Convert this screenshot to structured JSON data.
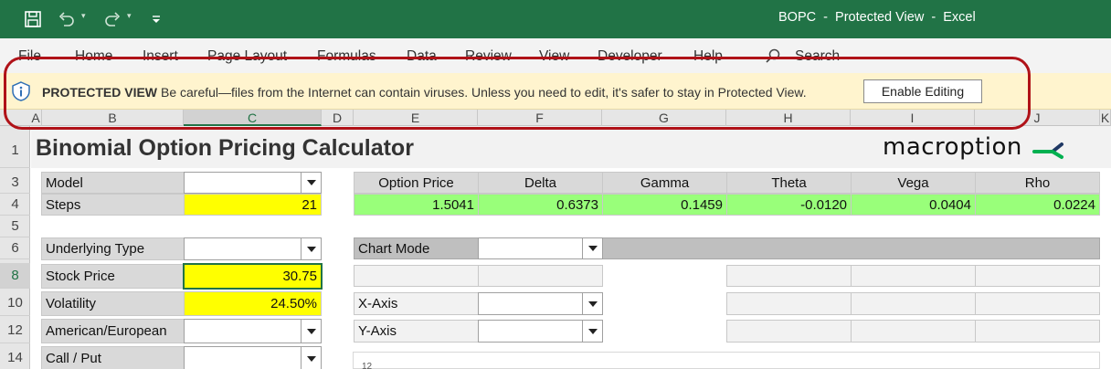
{
  "window": {
    "title": "BOPC  -  Protected View  -  Excel"
  },
  "ribbon": {
    "tabs": [
      "File",
      "Home",
      "Insert",
      "Page Layout",
      "Formulas",
      "Data",
      "Review",
      "View",
      "Developer",
      "Help"
    ],
    "search_label": "Search"
  },
  "protected_view": {
    "title": "PROTECTED VIEW",
    "message": "Be careful—files from the Internet can contain viruses. Unless you need to edit, it's safer to stay in Protected View.",
    "button": "Enable Editing"
  },
  "columns": [
    "A",
    "B",
    "C",
    "D",
    "E",
    "F",
    "G",
    "H",
    "I",
    "J",
    "K"
  ],
  "rows": [
    "1",
    "3",
    "4",
    "5",
    "6",
    "8",
    "10",
    "12",
    "14"
  ],
  "sheet": {
    "title": "Binomial Option Pricing Calculator",
    "logo": "macroption",
    "labels": {
      "model": "Model",
      "steps": "Steps",
      "underlying_type": "Underlying Type",
      "stock_price": "Stock Price",
      "volatility": "Volatility",
      "american_european": "American/European",
      "call_put": "Call / Put",
      "chart_mode": "Chart Mode",
      "x_axis": "X-Axis",
      "y_axis": "Y-Axis"
    },
    "values": {
      "steps": "21",
      "stock_price": "30.75",
      "volatility": "24.50%"
    },
    "results_headers": [
      "Option Price",
      "Delta",
      "Gamma",
      "Theta",
      "Vega",
      "Rho"
    ],
    "results_values": [
      "1.5041",
      "0.6373",
      "0.1459",
      "-0.0120",
      "0.0404",
      "0.0224"
    ],
    "chart_tick": "12"
  },
  "colors": {
    "excel_green": "#217346",
    "result_green": "#99ff7a",
    "input_yellow": "#ffff00",
    "annotation_red": "#b01218"
  }
}
